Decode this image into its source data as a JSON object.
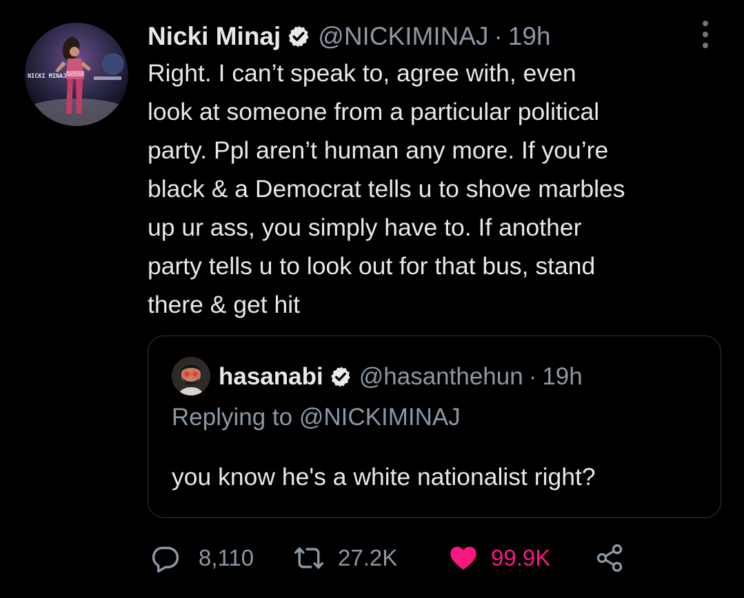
{
  "tweet": {
    "author_name": "Nicki Minaj",
    "author_handle": "@NICKIMINAJ",
    "separator": "·",
    "time": "19h",
    "avatar_text": "NICKI MINAJ",
    "body_lines": [
      "Right. I can’t speak to, agree with, even",
      "look at someone from a particular political",
      "party. Ppl aren’t human any more. If you’re",
      "black & a Democrat tells u to shove marbles",
      "up ur ass, you simply have to. If another",
      "party tells u to look out for that bus, stand",
      "there & get hit"
    ]
  },
  "quoted": {
    "author_name": "hasanabi",
    "author_handle": "@hasanthehun",
    "separator": "·",
    "time": "19h",
    "replying_to": "Replying to @NICKIMINAJ",
    "text": "you know he's a white nationalist right?"
  },
  "actions": {
    "reply_count": "8,110",
    "retweet_count": "27.2K",
    "like_count": "99.9K"
  },
  "icons": {
    "verified": "verified-badge-icon",
    "more": "more-vertical-icon",
    "reply": "reply-bubble-icon",
    "retweet": "retweet-icon",
    "like": "heart-filled-icon",
    "share": "share-icon"
  },
  "colors": {
    "background": "#000000",
    "text": "#e7e9ea",
    "secondary": "#8b98a5",
    "like": "#f91880",
    "border": "#333639"
  }
}
